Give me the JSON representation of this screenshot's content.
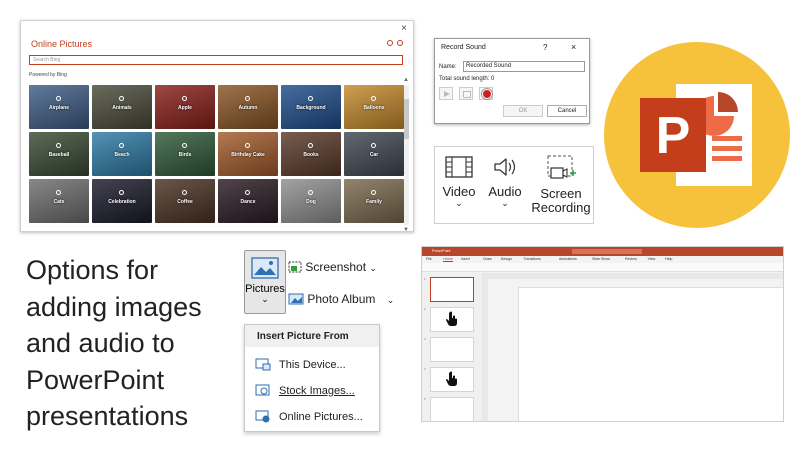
{
  "online_pictures": {
    "close_glyph": "×",
    "title": "Online Pictures",
    "search_placeholder": "Search Bing",
    "powered_by": "Powered by Bing",
    "tiles": [
      {
        "label": "Airplane",
        "color": "#3f5d86"
      },
      {
        "label": "Animals",
        "color": "#4a4a3a"
      },
      {
        "label": "Apple",
        "color": "#8a1f1a"
      },
      {
        "label": "Autumn",
        "color": "#8a5524"
      },
      {
        "label": "Background",
        "color": "#1e4e8c"
      },
      {
        "label": "Balloons",
        "color": "#c58a2c"
      },
      {
        "label": "Baseball",
        "color": "#3a4b33"
      },
      {
        "label": "Beach",
        "color": "#2e7ba6"
      },
      {
        "label": "Birds",
        "color": "#2f5a38"
      },
      {
        "label": "Birthday Cake",
        "color": "#a35c2c"
      },
      {
        "label": "Books",
        "color": "#5b3a2a"
      },
      {
        "label": "Car",
        "color": "#404852"
      },
      {
        "label": "Cats",
        "color": "#6e6e6e"
      },
      {
        "label": "Celebration",
        "color": "#1b1b2b"
      },
      {
        "label": "Coffee",
        "color": "#4a3223"
      },
      {
        "label": "Dance",
        "color": "#2b1b24"
      },
      {
        "label": "Dog",
        "color": "#8f8f8f"
      },
      {
        "label": "Family",
        "color": "#7b6a4e"
      }
    ]
  },
  "record_sound": {
    "title": "Record Sound",
    "help": "?",
    "close": "×",
    "name_label": "Name:",
    "name_value": "Recorded Sound",
    "total_length_label": "Total sound length:",
    "total_length_value": "0",
    "ok": "OK",
    "cancel": "Cancel"
  },
  "media": {
    "video": "Video",
    "audio": "Audio",
    "screen_recording_line1": "Screen",
    "screen_recording_line2": "Recording",
    "chevron": "⌄"
  },
  "caption": {
    "line1": "Options for",
    "line2": "adding images",
    "line3": "and audio to",
    "line4": "PowerPoint",
    "line5": "presentations"
  },
  "insert_pictures": {
    "pictures": "Pictures",
    "screenshot": "Screenshot",
    "photo_album": "Photo Album",
    "menu_header": "Insert Picture From",
    "this_device": "This Device...",
    "stock_images": "Stock Images...",
    "online_pictures": "Online Pictures..."
  },
  "ppt_window": {
    "app_name": "PowerPoint",
    "menu": [
      "File",
      "Home",
      "Insert",
      "Draw",
      "Design",
      "Transitions",
      "Animations",
      "Slide Show",
      "Review",
      "View",
      "Help"
    ],
    "slide_numbers": [
      "1",
      "2",
      "3",
      "4",
      "5"
    ]
  },
  "colors": {
    "ppt_orange": "#c43e1c",
    "ppt_logo_bg": "#f6c23b",
    "ppt_logo_dark": "#b7472a",
    "ppt_logo_light": "#ed6c47"
  }
}
